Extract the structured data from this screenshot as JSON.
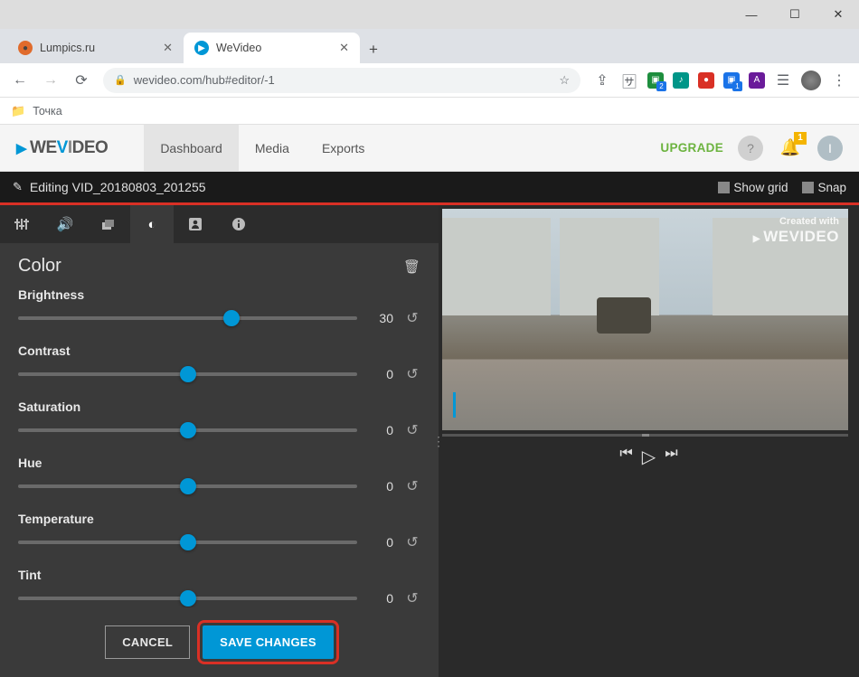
{
  "window": {
    "min": "—",
    "max": "☐",
    "close": "✕"
  },
  "tabs": [
    {
      "title": "Lumpics.ru",
      "favcolor": "#e06b2c"
    },
    {
      "title": "WeVideo",
      "favcolor": "#0097d6"
    }
  ],
  "url": "wevideo.com/hub#editor/-1",
  "bookmark": "Точка",
  "logo": {
    "pre": "WE",
    "mid": "V",
    "post": "DEO",
    "i": "I"
  },
  "mainnav": [
    {
      "label": "Dashboard",
      "active": true
    },
    {
      "label": "Media",
      "active": false
    },
    {
      "label": "Exports",
      "active": false
    }
  ],
  "upgrade": "UPGRADE",
  "notif_count": "1",
  "editing": {
    "prefix": "Editing",
    "name": "VID_20180803_201255"
  },
  "showgrid": "Show grid",
  "snap": "Snap",
  "panel_title": "Color",
  "sliders": [
    {
      "label": "Brightness",
      "value": "30",
      "pos": 63
    },
    {
      "label": "Contrast",
      "value": "0",
      "pos": 50
    },
    {
      "label": "Saturation",
      "value": "0",
      "pos": 50
    },
    {
      "label": "Hue",
      "value": "0",
      "pos": 50
    },
    {
      "label": "Temperature",
      "value": "0",
      "pos": 50
    },
    {
      "label": "Tint",
      "value": "0",
      "pos": 50
    }
  ],
  "cancel": "CANCEL",
  "save": "SAVE CHANGES",
  "watermark": {
    "small": "Created with",
    "big": "WEVIDEO"
  },
  "ext_badges": {
    "a": "2",
    "b": "1"
  }
}
